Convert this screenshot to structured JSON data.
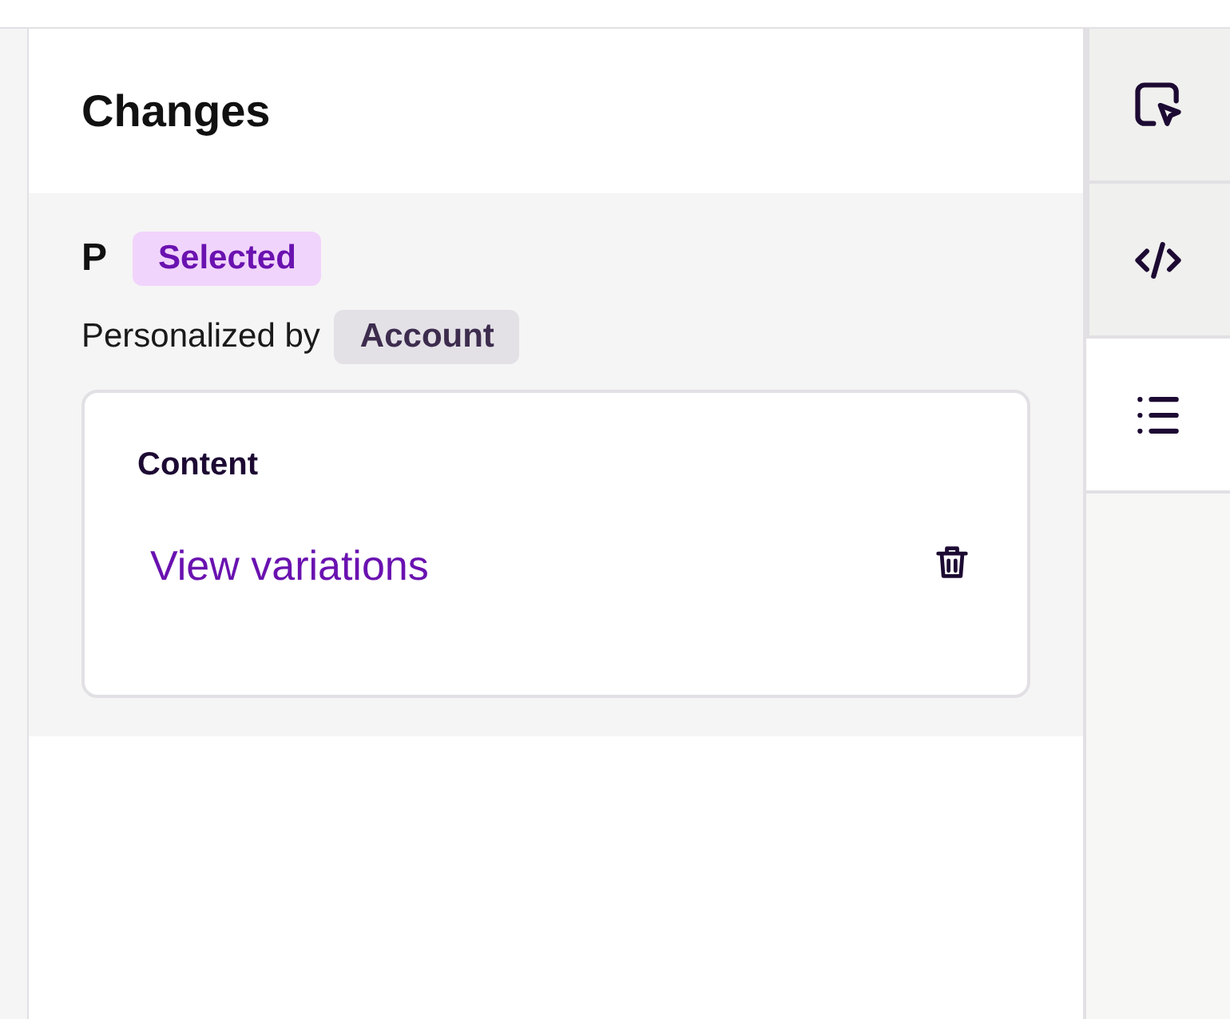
{
  "panel": {
    "title": "Changes"
  },
  "change": {
    "element": "P",
    "state_badge": "Selected",
    "personalized_label": "Personalized by",
    "personalized_by": "Account",
    "card": {
      "heading": "Content",
      "link": "View variations"
    }
  },
  "rail_tabs": [
    {
      "kind": "select",
      "selected": false
    },
    {
      "kind": "code",
      "selected": false
    },
    {
      "kind": "list",
      "selected": true
    }
  ]
}
